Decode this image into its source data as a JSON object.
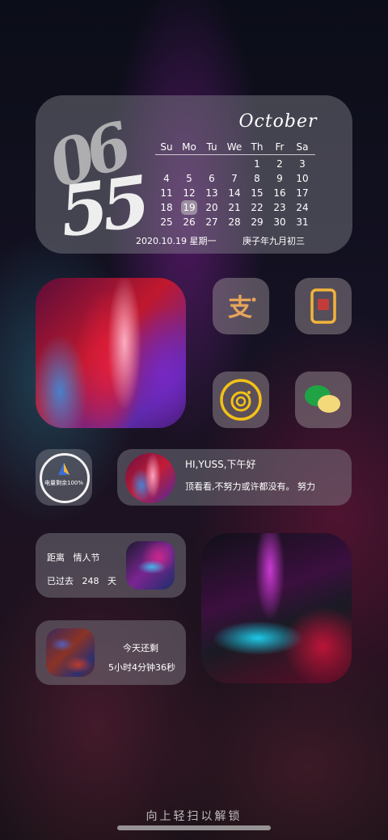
{
  "calendar": {
    "hour": "06",
    "minute": "55",
    "month": "October",
    "weekdays": [
      "Su",
      "Mo",
      "Tu",
      "We",
      "Th",
      "Fr",
      "Sa"
    ],
    "days": [
      "",
      "",
      "",
      "",
      "1",
      "2",
      "3",
      "4",
      "5",
      "6",
      "7",
      "8",
      "9",
      "10",
      "11",
      "12",
      "13",
      "14",
      "15",
      "16",
      "17",
      "18",
      "19",
      "20",
      "21",
      "22",
      "23",
      "24",
      "25",
      "26",
      "27",
      "28",
      "29",
      "30",
      "31"
    ],
    "today": "19",
    "date_line": "2020.10.19 星期一",
    "lunar_line": "庚子年九月初三"
  },
  "apps": {
    "alipay": {
      "glyph": "支",
      "color": "#e6a55a"
    },
    "phone": {
      "color": "#f2b43a"
    },
    "camera": {
      "color": "#f3c214"
    },
    "wechat": {
      "color": "#20a344"
    }
  },
  "battery": {
    "label": "电量剩余100%",
    "level": 100
  },
  "greeting": {
    "title": "HI,YUSS,下午好",
    "message": "顶看看,不努力或许都没有。     努力"
  },
  "valentine": {
    "line1_a": "距离",
    "line1_b": "情人节",
    "line2_a": "已过去",
    "line2_b": "248",
    "line2_c": "天"
  },
  "countdown": {
    "line1": "今天还剩",
    "line2": "5小时4分钟36秒"
  },
  "lockscreen": {
    "unlock_hint": "向上轻扫以解锁"
  }
}
